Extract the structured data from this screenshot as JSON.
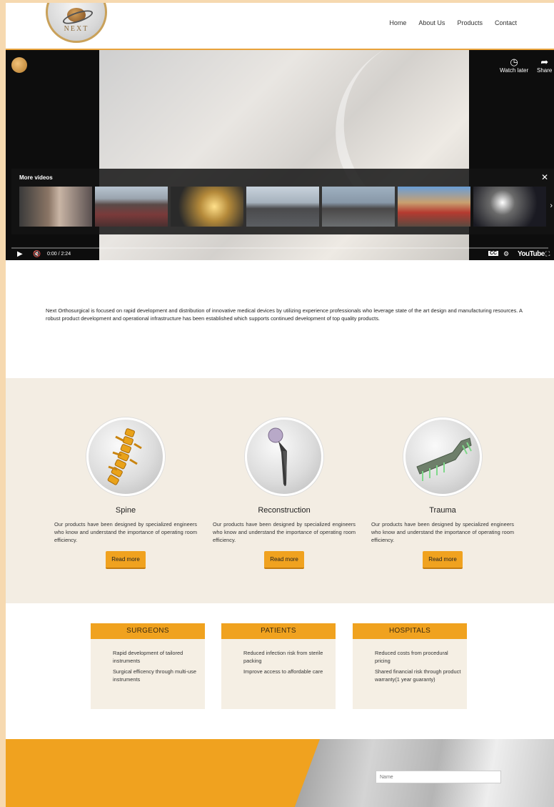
{
  "header": {
    "logo_text": "NEXT",
    "nav": [
      "Home",
      "About Us",
      "Products",
      "Contact"
    ]
  },
  "video": {
    "watch_later": "Watch later",
    "share": "Share",
    "more_videos": "More videos",
    "time": "0:00 / 2:24",
    "brand": "YouTube",
    "progress": 0
  },
  "intro": {
    "text": "Next Orthosurgical is focused on rapid development and distribution of innovative medical devices by utilizing experience professionals who leverage state of the art design and manufacturing resources. A robust product development and operational infrastructure has been established which supports continued development of top quality products."
  },
  "products": [
    {
      "title": "Spine",
      "text": "Our products have been designed by specialized engineers who know and understand the importance of operating room efficiency.",
      "button": "Read more"
    },
    {
      "title": "Reconstruction",
      "text": "Our products have been designed by specialized engineers who know and understand the importance of operating room efficiency.",
      "button": "Read more"
    },
    {
      "title": "Trauma",
      "text": "Our products have been designed by specialized engineers who know and understand the importance of operating room efficiency.",
      "button": "Read more"
    }
  ],
  "benefits": [
    {
      "title": "SURGEONS",
      "items": [
        "Rapid development of tailored instruments",
        "Surgical efficency through multi-use instruments"
      ]
    },
    {
      "title": "PATIENTS",
      "items": [
        "Reduced infection risk from sterile packing",
        "Improve access to affordable care"
      ]
    },
    {
      "title": "HOSPITALS",
      "items": [
        "Reduced costs from procedural pricing",
        "Shared financial risk through product warranty(1 year guaranty)"
      ]
    }
  ],
  "contact": {
    "name_placeholder": "Name"
  },
  "colors": {
    "accent": "#f0a21f",
    "section_bg": "#f3ede3",
    "outer_bg": "#f6d9b0"
  }
}
